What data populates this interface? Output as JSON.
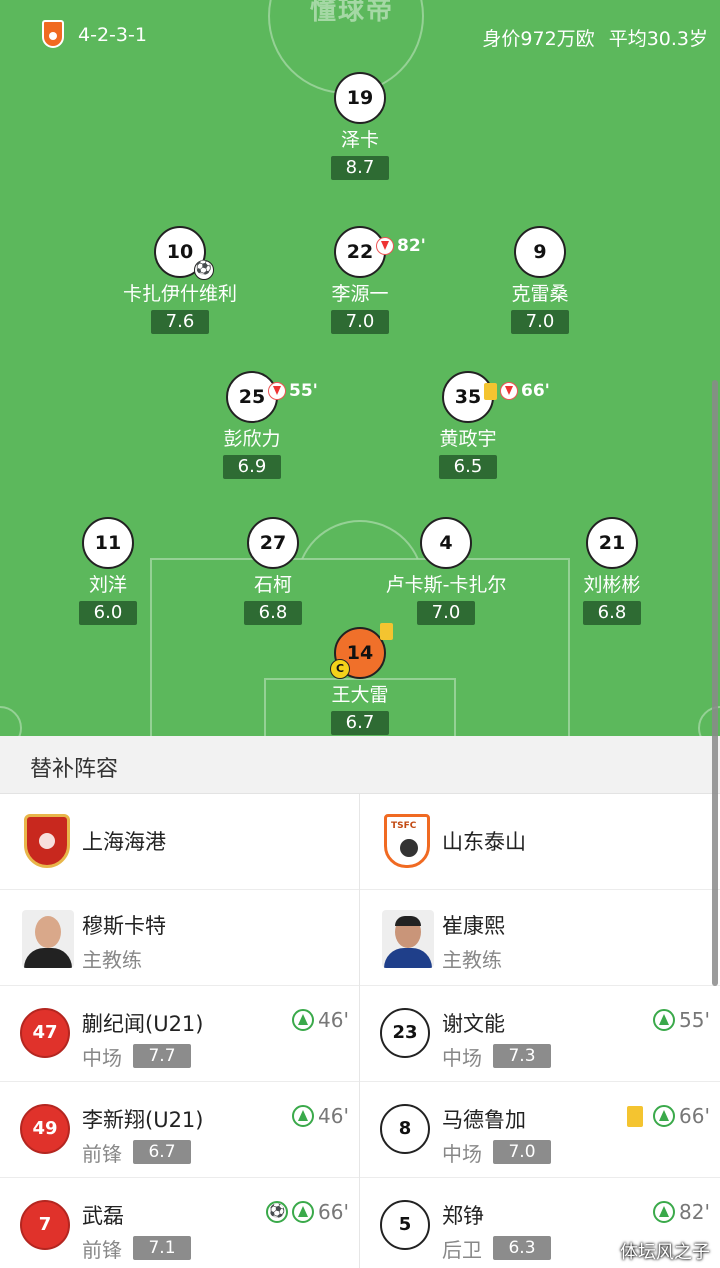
{
  "header": {
    "formation": "4-2-3-1",
    "squad_value": "身价972万欧",
    "avg_age": "平均30.3岁",
    "watermark": "懂球帝"
  },
  "lineup": {
    "st": {
      "number": "19",
      "name": "泽卡",
      "rating": "8.7"
    },
    "am_l": {
      "number": "10",
      "name": "卡扎伊什维利",
      "rating": "7.6",
      "goal_icon": "⚽"
    },
    "am_c": {
      "number": "22",
      "name": "李源一",
      "rating": "7.0",
      "sub_off": "82'"
    },
    "am_r": {
      "number": "9",
      "name": "克雷桑",
      "rating": "7.0"
    },
    "dm_l": {
      "number": "25",
      "name": "彭欣力",
      "rating": "6.9",
      "sub_off": "55'"
    },
    "dm_r": {
      "number": "35",
      "name": "黄政宇",
      "rating": "6.5",
      "sub_off": "66'"
    },
    "lb": {
      "number": "11",
      "name": "刘洋",
      "rating": "6.0"
    },
    "cb_l": {
      "number": "27",
      "name": "石柯",
      "rating": "6.8"
    },
    "cb_r": {
      "number": "4",
      "name": "卢卡斯-卡扎尔",
      "rating": "7.0"
    },
    "rb": {
      "number": "21",
      "name": "刘彬彬",
      "rating": "6.8"
    },
    "gk": {
      "number": "14",
      "name": "王大雷",
      "rating": "6.7",
      "captain": "C"
    }
  },
  "subs": {
    "title": "替补阵容",
    "left": {
      "team": "上海海港",
      "coach": {
        "name": "穆斯卡特",
        "role": "主教练"
      },
      "players": [
        {
          "number": "47",
          "name": "蒯纪闻(U21)",
          "position": "中场",
          "rating": "7.7",
          "sub_in": "46'"
        },
        {
          "number": "49",
          "name": "李新翔(U21)",
          "position": "前锋",
          "rating": "6.7",
          "sub_in": "46'"
        },
        {
          "number": "7",
          "name": "武磊",
          "position": "前锋",
          "rating": "7.1",
          "goal_icon": "⚽",
          "sub_in": "66'"
        }
      ]
    },
    "right": {
      "team": "山东泰山",
      "coach": {
        "name": "崔康熙",
        "role": "主教练"
      },
      "players": [
        {
          "number": "23",
          "name": "谢文能",
          "position": "中场",
          "rating": "7.3",
          "sub_in": "55'"
        },
        {
          "number": "8",
          "name": "马德鲁加",
          "position": "中场",
          "rating": "7.0",
          "sub_in": "66'"
        },
        {
          "number": "5",
          "name": "郑铮",
          "position": "后卫",
          "rating": "6.3",
          "sub_in": "82'"
        }
      ]
    }
  },
  "site_watermark": "体坛风之子"
}
